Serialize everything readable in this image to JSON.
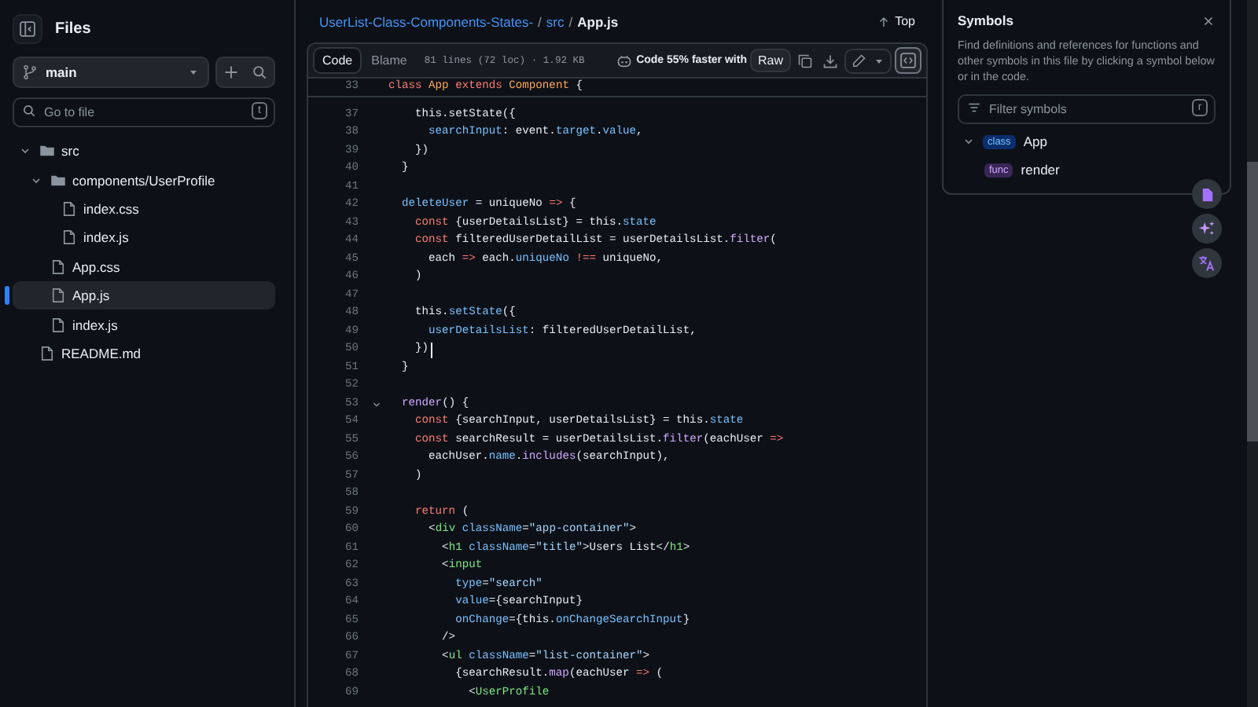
{
  "sidebar": {
    "title": "Files",
    "branch": "main",
    "search": {
      "placeholder": "Go to file",
      "shortcut": "t"
    },
    "tree": [
      {
        "kind": "folder",
        "name": "src",
        "expanded": true,
        "selected": false,
        "children": [
          {
            "kind": "folder",
            "name": "components/UserProfile",
            "expanded": true,
            "selected": false,
            "children": [
              {
                "kind": "file",
                "name": "index.css",
                "selected": false
              },
              {
                "kind": "file",
                "name": "index.js",
                "selected": false
              }
            ]
          },
          {
            "kind": "file",
            "name": "App.css",
            "selected": false
          },
          {
            "kind": "file",
            "name": "App.js",
            "selected": true
          },
          {
            "kind": "file",
            "name": "index.js",
            "selected": false
          }
        ]
      },
      {
        "kind": "file",
        "name": "README.md",
        "selected": false
      }
    ]
  },
  "breadcrumb": {
    "path": [
      {
        "kind": "link",
        "text": "UserList-Class-Components-States-"
      },
      {
        "kind": "sep",
        "text": "/"
      },
      {
        "kind": "link",
        "text": "src"
      },
      {
        "kind": "sep",
        "text": "/"
      },
      {
        "kind": "current",
        "text": "App.js"
      }
    ],
    "top_link": "Top"
  },
  "toolbar": {
    "tabs": [
      {
        "label": "Code",
        "selected": true
      },
      {
        "label": "Blame",
        "selected": false
      }
    ],
    "file_info": "81 lines (72 loc) · 1.92 KB",
    "copilot_promo": "Code 55% faster with",
    "raw_button": "Raw",
    "symbols_toggle_on": true
  },
  "code": {
    "sticky_line": {
      "number": "33",
      "tokens": [
        {
          "kind": "kw",
          "text": "class "
        },
        {
          "kind": "cls",
          "text": "App "
        },
        {
          "kind": "kw",
          "text": "extends "
        },
        {
          "kind": "cls",
          "text": "Component "
        },
        {
          "kind": "plain",
          "text": "{"
        }
      ]
    },
    "lines": [
      {
        "number": "37",
        "fold": false,
        "cursor": false,
        "tokens": [
          {
            "kind": "plain",
            "text": "    this.setState({"
          }
        ]
      },
      {
        "number": "38",
        "fold": false,
        "cursor": false,
        "tokens": [
          {
            "kind": "prop",
            "text": "      searchInput"
          },
          {
            "kind": "plain",
            "text": ": event."
          },
          {
            "kind": "prop",
            "text": "target"
          },
          {
            "kind": "plain",
            "text": "."
          },
          {
            "kind": "prop",
            "text": "value"
          },
          {
            "kind": "plain",
            "text": ","
          }
        ]
      },
      {
        "number": "39",
        "fold": false,
        "cursor": false,
        "tokens": [
          {
            "kind": "plain",
            "text": "    })"
          }
        ]
      },
      {
        "number": "40",
        "fold": false,
        "cursor": false,
        "tokens": [
          {
            "kind": "plain",
            "text": "  }"
          }
        ]
      },
      {
        "number": "41",
        "fold": false,
        "cursor": false
      },
      {
        "number": "42",
        "fold": false,
        "cursor": false,
        "tokens": [
          {
            "kind": "prop",
            "text": "  deleteUser"
          },
          {
            "kind": "plain",
            "text": " = uniqueNo "
          },
          {
            "kind": "kw",
            "text": "=>"
          },
          {
            "kind": "plain",
            "text": " {"
          }
        ]
      },
      {
        "number": "43",
        "fold": false,
        "cursor": false,
        "tokens": [
          {
            "kind": "kw",
            "text": "    const"
          },
          {
            "kind": "plain",
            "text": " {userDetailsList} = this."
          },
          {
            "kind": "prop",
            "text": "state"
          }
        ]
      },
      {
        "number": "44",
        "fold": false,
        "cursor": false,
        "tokens": [
          {
            "kind": "kw",
            "text": "    const"
          },
          {
            "kind": "plain",
            "text": " filteredUserDetailList = userDetailsList."
          },
          {
            "kind": "fn",
            "text": "filter"
          },
          {
            "kind": "plain",
            "text": "("
          }
        ]
      },
      {
        "number": "45",
        "fold": false,
        "cursor": false,
        "tokens": [
          {
            "kind": "plain",
            "text": "      each "
          },
          {
            "kind": "kw",
            "text": "=>"
          },
          {
            "kind": "plain",
            "text": " each."
          },
          {
            "kind": "prop",
            "text": "uniqueNo "
          },
          {
            "kind": "kw",
            "text": "!=="
          },
          {
            "kind": "plain",
            "text": " uniqueNo,"
          }
        ]
      },
      {
        "number": "46",
        "fold": false,
        "cursor": false,
        "tokens": [
          {
            "kind": "plain",
            "text": "    )"
          }
        ]
      },
      {
        "number": "47",
        "fold": false,
        "cursor": false
      },
      {
        "number": "48",
        "fold": false,
        "cursor": false,
        "tokens": [
          {
            "kind": "plain",
            "text": "    this."
          },
          {
            "kind": "prop",
            "text": "setState"
          },
          {
            "kind": "plain",
            "text": "({"
          }
        ]
      },
      {
        "number": "49",
        "fold": false,
        "cursor": false,
        "tokens": [
          {
            "kind": "prop",
            "text": "      userDetailsList"
          },
          {
            "kind": "plain",
            "text": ": filteredUserDetailList,"
          }
        ]
      },
      {
        "number": "50",
        "fold": false,
        "cursor": true,
        "tokens": [
          {
            "kind": "plain",
            "text": "    })"
          }
        ]
      },
      {
        "number": "51",
        "fold": false,
        "cursor": false,
        "tokens": [
          {
            "kind": "plain",
            "text": "  }"
          }
        ]
      },
      {
        "number": "52",
        "fold": false,
        "cursor": false
      },
      {
        "number": "53",
        "fold": true,
        "cursor": false,
        "tokens": [
          {
            "kind": "fn",
            "text": "  render"
          },
          {
            "kind": "plain",
            "text": "() {"
          }
        ]
      },
      {
        "number": "54",
        "fold": false,
        "cursor": false,
        "tokens": [
          {
            "kind": "kw",
            "text": "    const"
          },
          {
            "kind": "plain",
            "text": " {searchInput, userDetailsList} = this."
          },
          {
            "kind": "prop",
            "text": "state"
          }
        ]
      },
      {
        "number": "55",
        "fold": false,
        "cursor": false,
        "tokens": [
          {
            "kind": "kw",
            "text": "    const"
          },
          {
            "kind": "plain",
            "text": " searchResult = userDetailsList."
          },
          {
            "kind": "fn",
            "text": "filter"
          },
          {
            "kind": "plain",
            "text": "(eachUser "
          },
          {
            "kind": "kw",
            "text": "=>"
          }
        ]
      },
      {
        "number": "56",
        "fold": false,
        "cursor": false,
        "tokens": [
          {
            "kind": "plain",
            "text": "      eachUser."
          },
          {
            "kind": "prop",
            "text": "name"
          },
          {
            "kind": "plain",
            "text": "."
          },
          {
            "kind": "fn",
            "text": "includes"
          },
          {
            "kind": "plain",
            "text": "(searchInput),"
          }
        ]
      },
      {
        "number": "57",
        "fold": false,
        "cursor": false,
        "tokens": [
          {
            "kind": "plain",
            "text": "    )"
          }
        ]
      },
      {
        "number": "58",
        "fold": false,
        "cursor": false
      },
      {
        "number": "59",
        "fold": false,
        "cursor": false,
        "tokens": [
          {
            "kind": "kw",
            "text": "    return"
          },
          {
            "kind": "plain",
            "text": " ("
          }
        ]
      },
      {
        "number": "60",
        "fold": false,
        "cursor": false,
        "tokens": [
          {
            "kind": "plain",
            "text": "      <"
          },
          {
            "kind": "tag",
            "text": "div "
          },
          {
            "kind": "prop",
            "text": "className"
          },
          {
            "kind": "plain",
            "text": "="
          },
          {
            "kind": "str",
            "text": "\"app-container\""
          },
          {
            "kind": "plain",
            "text": ">"
          }
        ]
      },
      {
        "number": "61",
        "fold": false,
        "cursor": false,
        "tokens": [
          {
            "kind": "plain",
            "text": "        <"
          },
          {
            "kind": "tag",
            "text": "h1 "
          },
          {
            "kind": "prop",
            "text": "className"
          },
          {
            "kind": "plain",
            "text": "="
          },
          {
            "kind": "str",
            "text": "\"title\""
          },
          {
            "kind": "plain",
            "text": ">Users List</"
          },
          {
            "kind": "tag",
            "text": "h1"
          },
          {
            "kind": "plain",
            "text": ">"
          }
        ]
      },
      {
        "number": "62",
        "fold": false,
        "cursor": false,
        "tokens": [
          {
            "kind": "plain",
            "text": "        <"
          },
          {
            "kind": "tag",
            "text": "input"
          }
        ]
      },
      {
        "number": "63",
        "fold": false,
        "cursor": false,
        "tokens": [
          {
            "kind": "prop",
            "text": "          type"
          },
          {
            "kind": "plain",
            "text": "="
          },
          {
            "kind": "str",
            "text": "\"search\""
          }
        ]
      },
      {
        "number": "64",
        "fold": false,
        "cursor": false,
        "tokens": [
          {
            "kind": "prop",
            "text": "          value"
          },
          {
            "kind": "plain",
            "text": "={searchInput}"
          }
        ]
      },
      {
        "number": "65",
        "fold": false,
        "cursor": false,
        "tokens": [
          {
            "kind": "prop",
            "text": "          onChange"
          },
          {
            "kind": "plain",
            "text": "={this."
          },
          {
            "kind": "prop",
            "text": "onChangeSearchInput"
          },
          {
            "kind": "plain",
            "text": "}"
          }
        ]
      },
      {
        "number": "66",
        "fold": false,
        "cursor": false,
        "tokens": [
          {
            "kind": "plain",
            "text": "        />"
          }
        ]
      },
      {
        "number": "67",
        "fold": false,
        "cursor": false,
        "tokens": [
          {
            "kind": "plain",
            "text": "        <"
          },
          {
            "kind": "tag",
            "text": "ul "
          },
          {
            "kind": "prop",
            "text": "className"
          },
          {
            "kind": "plain",
            "text": "="
          },
          {
            "kind": "str",
            "text": "\"list-container\""
          },
          {
            "kind": "plain",
            "text": ">"
          }
        ]
      },
      {
        "number": "68",
        "fold": false,
        "cursor": false,
        "tokens": [
          {
            "kind": "plain",
            "text": "          {searchResult."
          },
          {
            "kind": "fn",
            "text": "map"
          },
          {
            "kind": "plain",
            "text": "(eachUser "
          },
          {
            "kind": "kw",
            "text": "=>"
          },
          {
            "kind": "plain",
            "text": " ("
          }
        ]
      },
      {
        "number": "69",
        "fold": false,
        "cursor": false,
        "tokens": [
          {
            "kind": "plain",
            "text": "            <"
          },
          {
            "kind": "tag",
            "text": "UserProfile"
          }
        ]
      }
    ]
  },
  "symbols": {
    "title": "Symbols",
    "description": "Find definitions and references for functions and other symbols in this file by clicking a symbol below or in the code.",
    "filter": {
      "placeholder": "Filter symbols",
      "shortcut": "r"
    },
    "tree": [
      {
        "kind": "class",
        "badge": "class",
        "name": "App",
        "expanded": true,
        "children": [
          {
            "kind": "func",
            "badge": "func",
            "name": "render"
          }
        ]
      }
    ]
  }
}
